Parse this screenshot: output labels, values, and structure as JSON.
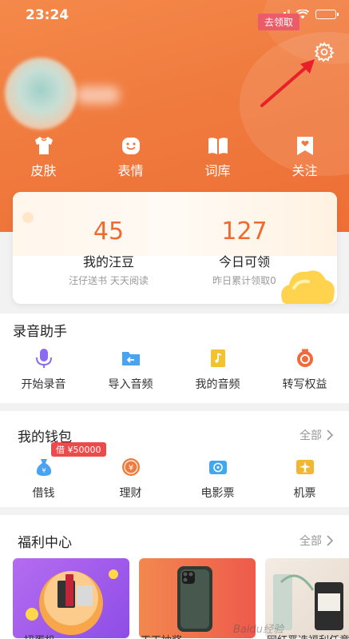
{
  "status_bar": {
    "time": "23:24"
  },
  "quick_actions": [
    {
      "label": "皮肤",
      "icon": "tshirt-icon"
    },
    {
      "label": "表情",
      "icon": "smiley-icon"
    },
    {
      "label": "词库",
      "icon": "book-icon"
    },
    {
      "label": "关注",
      "icon": "bookmark-heart-icon"
    }
  ],
  "beans_card": {
    "claim_tag": "去领取",
    "left": {
      "value": "45",
      "title": "我的汪豆",
      "subtitle": "汪仔送书 天天阅读"
    },
    "right": {
      "value": "127",
      "title": "今日可领",
      "subtitle": "昨日累计领取0"
    }
  },
  "recording": {
    "title": "录音助手",
    "items": [
      {
        "label": "开始录音",
        "icon": "microphone-icon",
        "color": "#8a6cf0"
      },
      {
        "label": "导入音频",
        "icon": "import-folder-icon",
        "color": "#4aa3f2"
      },
      {
        "label": "我的音频",
        "icon": "audio-file-icon",
        "color": "#f2c230"
      },
      {
        "label": "转写权益",
        "icon": "transcribe-icon",
        "color": "#f06a3c"
      }
    ]
  },
  "wallet": {
    "title": "我的钱包",
    "more_label": "全部",
    "loan_tag": "借 ¥50000",
    "items": [
      {
        "label": "借钱",
        "icon": "money-bag-icon",
        "color": "#4aa3f2"
      },
      {
        "label": "理财",
        "icon": "yuan-coin-icon",
        "color": "#f07a3c"
      },
      {
        "label": "电影票",
        "icon": "film-reel-icon",
        "color": "#3fa8f0"
      },
      {
        "label": "机票",
        "icon": "airplane-icon",
        "color": "#f2b630"
      }
    ]
  },
  "welfare": {
    "title": "福利中心",
    "more_label": "全部",
    "cards": [
      {
        "label": "扭蛋机"
      },
      {
        "label": "天天抽奖"
      },
      {
        "label": "网红严选福利任意"
      }
    ],
    "watermark": "Baidu经验"
  }
}
